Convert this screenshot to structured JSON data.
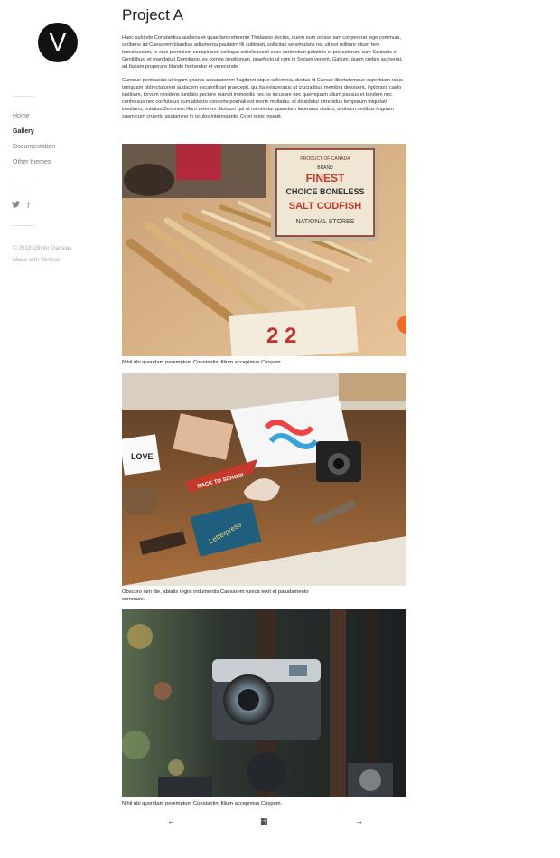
{
  "brand": {
    "logo_letter": "V"
  },
  "nav": {
    "items": [
      {
        "label": "Home",
        "active": false
      },
      {
        "label": "Gallery",
        "active": true
      },
      {
        "label": "Documentation",
        "active": false
      },
      {
        "label": "Other themes",
        "active": false
      }
    ]
  },
  "social": {
    "twitter_glyph": "🐦",
    "facebook_glyph": "f"
  },
  "footer": {
    "copyright": "© 2018 Olivier Gassias",
    "made_with": "Made with Vertical"
  },
  "page": {
    "title": "Project A",
    "paragraph1": "Haec subinde Constantius audiens et quaedam referente Thalassio doctus, quem eum odisse iam conpererat lege communi, scribens ad Caesarem blandius adiumenta paulatim illi subtraxit, sollicitari se simulans ne, uti est militare otium fere tumultuosum, in eius perniciem conspiraret, solisque scholis iussit esse contentum palatinis et protectorum cum Scutariis et Gentilibus, et mandabat Domitiano, ex comite largitionum, praefecto ut cum in Syriam venerit, Gallum, quem crebro acciverat, ad Italiam properare blande hortaretur et vereconde.",
    "paragraph2": "Cumque pertinacius ut legum gnarus accusatorem flagitaret atque sollemnia, doctus id Caesar libertatemque superbiam ratus tamquam obtrectatorem audacem excarnificari praecepit, qui ita evisceratus ut cruciatibus membra deessent, inplorans caelo iustitiam, torvum renidens fundato pectore mansit immobilis nec se incusare nec quemquam alium passus et tandem nec confessus nec confutatus cum abiecto consorte poenali est morte multatus. et dissidatur intrepidus temporum iniquitati insultans, imitatus Zenonem illum veterem Stoicum qui ut mentiretur quaedam laceratus diutius, avulsam sedibus linguam suam cum cruento sputamine in oculos interrogantis Cypri regis inpegit."
  },
  "captions": {
    "c1": "Nihil ubi quondam peremptum Constantini filium accepimus Crispum.",
    "c2": "Obscuro iam die, ablatis regiis indumentis Caesarem tunica texit et paludamento communi.",
    "c3": "Nihil ubi quondam peremptum Constantini filium accepimus Crispum."
  },
  "photo1_text": {
    "line1": "PRODUCT OF CANADA",
    "line2": "BRAND",
    "line3": "FINEST",
    "line4": "CHOICE BONELESS",
    "line5": "SALT CODFISH",
    "line6": "NATIONAL STORES"
  },
  "photo2_text": {
    "pennant": "BACK TO SCHOOL",
    "book": "LOVE",
    "box": "Letterpress"
  },
  "pager": {
    "prev_glyph": "←",
    "grid_glyph": "▦",
    "next_glyph": "→"
  },
  "colors": {
    "accent": "#111111",
    "text": "#222222",
    "muted": "#777777"
  }
}
